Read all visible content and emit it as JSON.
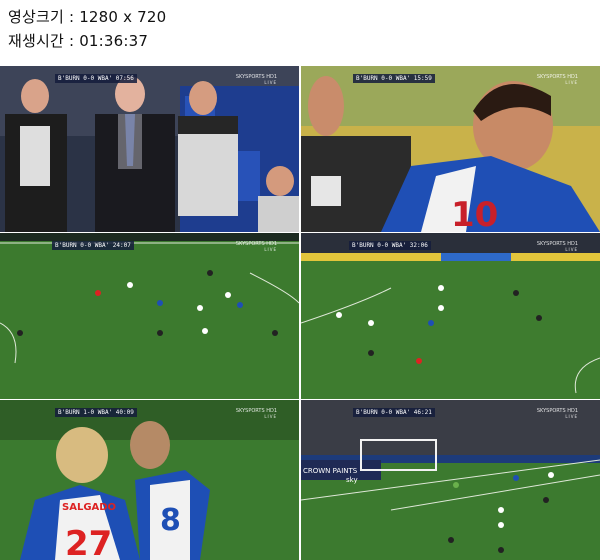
{
  "info": {
    "resolution_line": "영상크기 : 1280 x 720",
    "duration_line": "재생시간 : 01:36:37"
  },
  "thumbnails": [
    {
      "score": "B'BURN 0-0 WBA' 07:56"
    },
    {
      "score": "B'BURN 0-0 WBA' 15:59"
    },
    {
      "score": "B'BURN 0-0 WBA' 24:07"
    },
    {
      "score": "B'BURN 0-0 WBA' 32:06"
    },
    {
      "score": "B'BURN 1-0 WBA' 40:09"
    },
    {
      "score": "B'BURN 0-0 WBA' 46:21"
    }
  ],
  "channel": {
    "name": "SKYSPORTS HD1",
    "sub": "LIVE"
  },
  "jerseys": {
    "left_name": "SALGADO",
    "left_number": "27",
    "right_number": "8",
    "closeup_number": "10"
  },
  "boards": {
    "crown": "CROWN PAINTS",
    "sky": "sky"
  }
}
